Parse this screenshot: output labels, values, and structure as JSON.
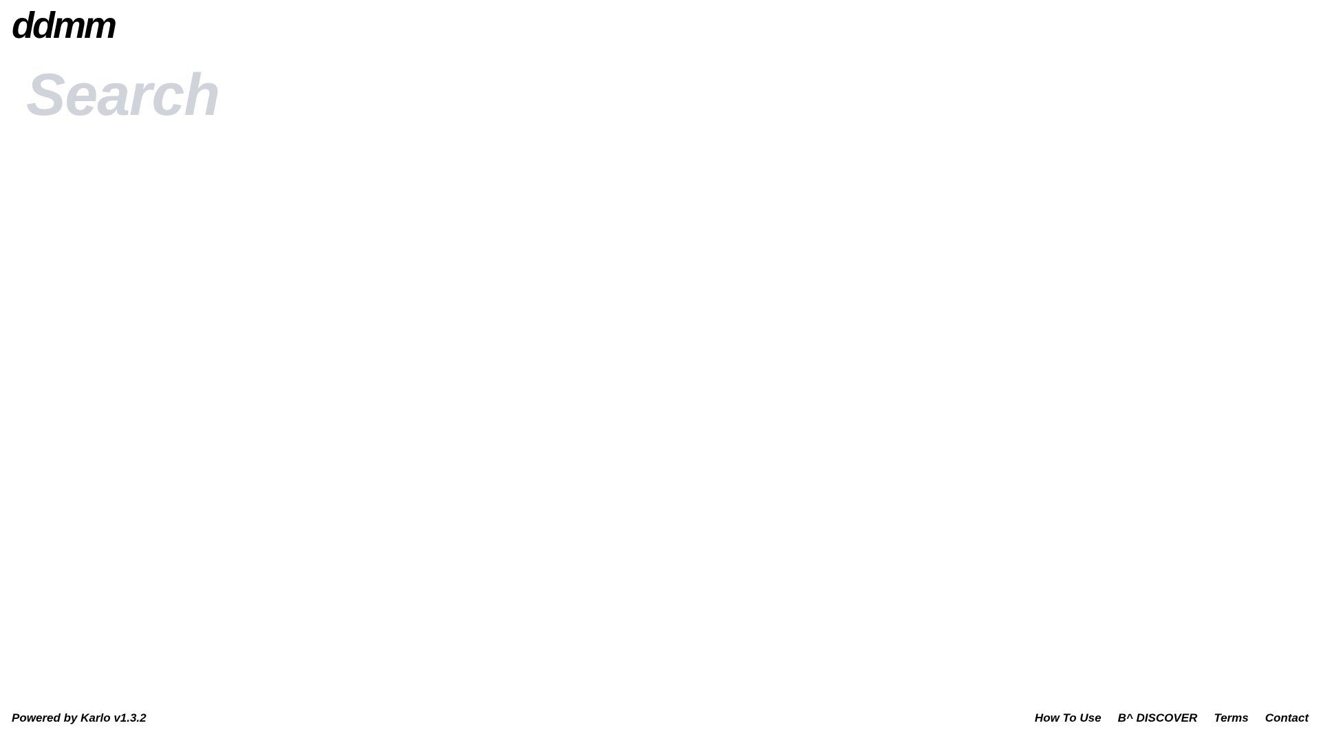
{
  "header": {
    "logo_text": "ddmm"
  },
  "search": {
    "placeholder": "Search",
    "value": ""
  },
  "footer": {
    "powered_by": "Powered by Karlo v1.3.2",
    "links": [
      {
        "label": "How To Use"
      },
      {
        "label": "B^ DISCOVER"
      },
      {
        "label": "Terms"
      },
      {
        "label": "Contact"
      }
    ]
  },
  "colors": {
    "background": "#ffffff",
    "text": "#000000",
    "placeholder": "#d1d3da"
  }
}
